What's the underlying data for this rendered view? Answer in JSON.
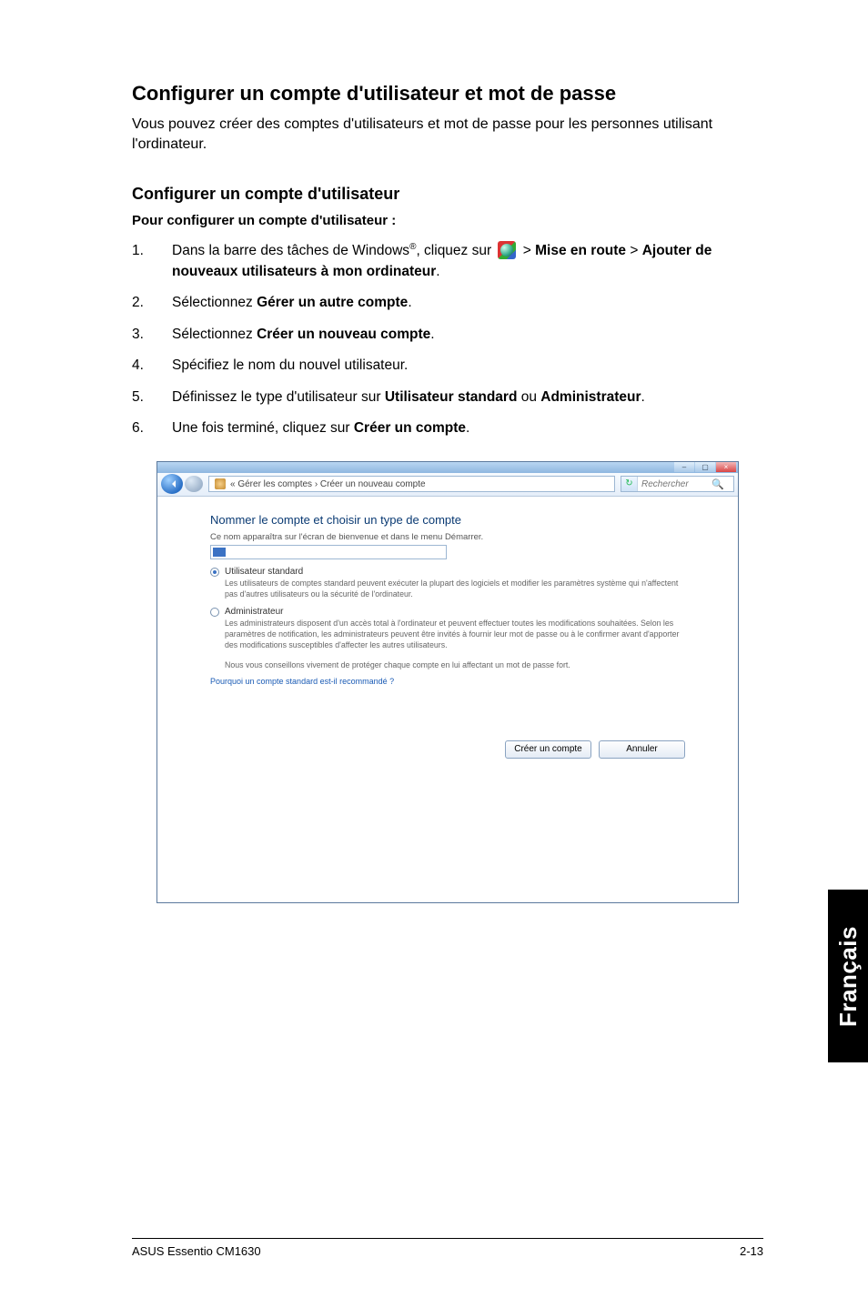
{
  "heading": "Configurer un compte d'utilisateur et mot de passe",
  "intro": "Vous pouvez créer des comptes d'utilisateurs et mot de passe pour les personnes utilisant l'ordinateur.",
  "sub1": "Configurer un compte d'utilisateur",
  "sub2": "Pour configurer un compte d'utilisateur :",
  "steps": [
    {
      "num": "1.",
      "pre": "Dans la barre des tâches de Windows",
      "sup": "®",
      "mid": ", cliquez sur ",
      "post1": " > ",
      "b1": "Mise en route",
      "post2": " > ",
      "b2": "Ajouter de nouveaux utilisateurs à mon ordinateur",
      "end": "."
    },
    {
      "num": "2.",
      "pre": "Sélectionnez ",
      "b1": "Gérer un autre compte",
      "end": "."
    },
    {
      "num": "3.",
      "pre": "Sélectionnez ",
      "b1": "Créer un nouveau compte",
      "end": "."
    },
    {
      "num": "4.",
      "pre": "Spécifiez le nom du nouvel utilisateur.",
      "b1": "",
      "end": ""
    },
    {
      "num": "5.",
      "pre": "Définissez le type d'utilisateur sur ",
      "b1": "Utilisateur standard",
      "mid": " ou ",
      "b2": "Administrateur",
      "end": "."
    },
    {
      "num": "6.",
      "pre": "Une fois terminé, cliquez sur ",
      "b1": "Créer un compte",
      "end": "."
    }
  ],
  "dialog": {
    "breadcrumb": "« Gérer les comptes  ›  Créer un nouveau compte",
    "search_placeholder": "Rechercher",
    "title": "Nommer le compte et choisir un type de compte",
    "subtitle": "Ce nom apparaîtra sur l'écran de bienvenue et dans le menu Démarrer.",
    "opt1_title": "Utilisateur standard",
    "opt1_desc": "Les utilisateurs de comptes standard peuvent exécuter la plupart des logiciels et modifier les paramètres système qui n'affectent pas d'autres utilisateurs ou la sécurité de l'ordinateur.",
    "opt2_title": "Administrateur",
    "opt2_desc": "Les administrateurs disposent d'un accès total à l'ordinateur et peuvent effectuer toutes les modifications souhaitées. Selon les paramètres de notification, les administrateurs peuvent être invités à fournir leur mot de passe ou à le confirmer avant d'apporter des modifications susceptibles d'affecter les autres utilisateurs.",
    "reco": "Nous vous conseillons vivement de protéger chaque compte en lui affectant un mot de passe fort.",
    "whylink": "Pourquoi un compte standard est-il recommandé ?",
    "btn_create": "Créer un compte",
    "btn_cancel": "Annuler"
  },
  "side_tab": "Français",
  "footer_left": "ASUS Essentio CM1630",
  "footer_right": "2-13"
}
